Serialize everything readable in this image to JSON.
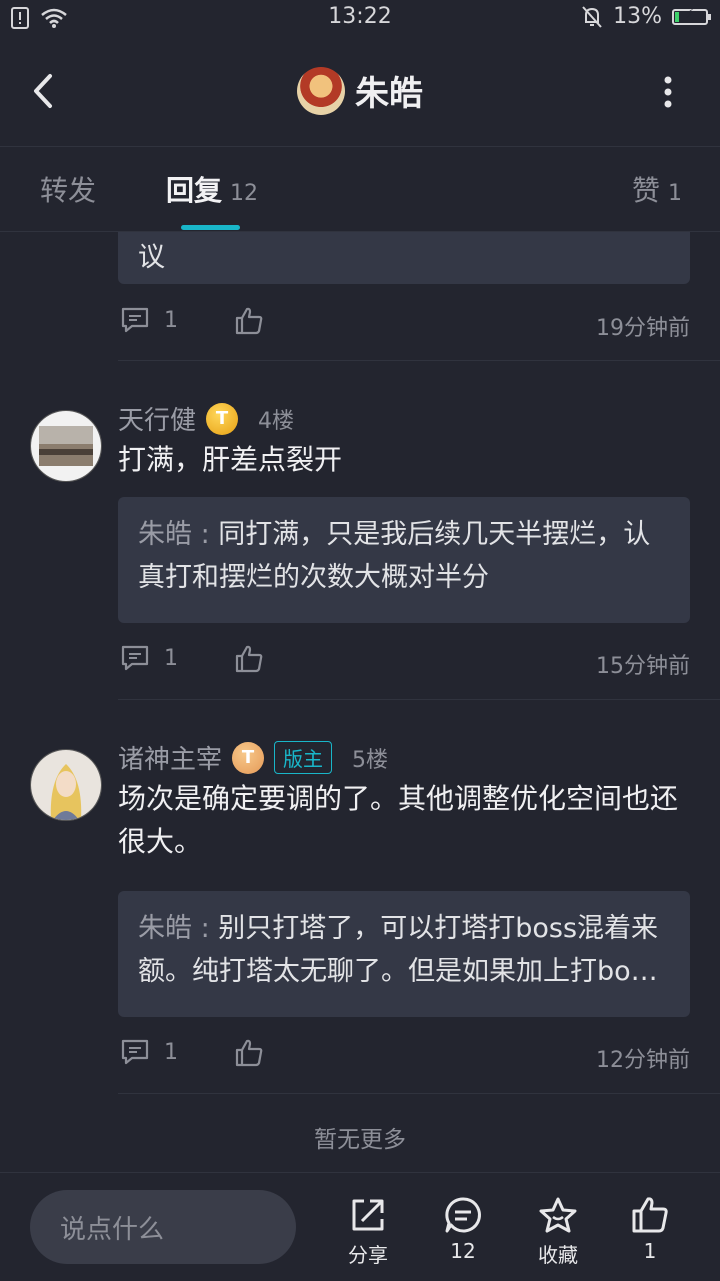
{
  "status_bar": {
    "time": "13:22",
    "battery": "13%",
    "battery_fraction": 0.13
  },
  "header": {
    "title": "朱皓"
  },
  "tabs": [
    {
      "label": "转发"
    },
    {
      "label": "回复",
      "count": "12"
    },
    {
      "label": "赞",
      "count": "1"
    }
  ],
  "top_card": {
    "quote_tail": "议",
    "comment_count": "1",
    "time": "19分钟前"
  },
  "posts": [
    {
      "name": "天行健",
      "badge": "T",
      "floor": "4楼",
      "content": "打满，肝差点裂开",
      "quote_name": "朱皓 : ",
      "quote_text": "同打满，只是我后续几天半摆烂，认真打和摆烂的次数大概对半分",
      "comment_count": "1",
      "time": "15分钟前"
    },
    {
      "name": "诸神主宰",
      "badge": "T",
      "mod_label": "版主",
      "floor": "5楼",
      "content": "场次是确定要调的了。其他调整优化空间也还很大。",
      "quote_name": "朱皓 : ",
      "quote_text": "别只打塔了，可以打塔打boss混着来额。纯打塔太无聊了。但是如果加上打bo…",
      "comment_count": "1",
      "time": "12分钟前"
    }
  ],
  "no_more": "暂无更多",
  "bottom_bar": {
    "input_placeholder": "说点什么",
    "share": "分享",
    "comments": "12",
    "favorite": "收藏",
    "likes": "1"
  },
  "colors": {
    "accent": "#19b6c9",
    "background": "#23252f",
    "card": "#343846"
  }
}
